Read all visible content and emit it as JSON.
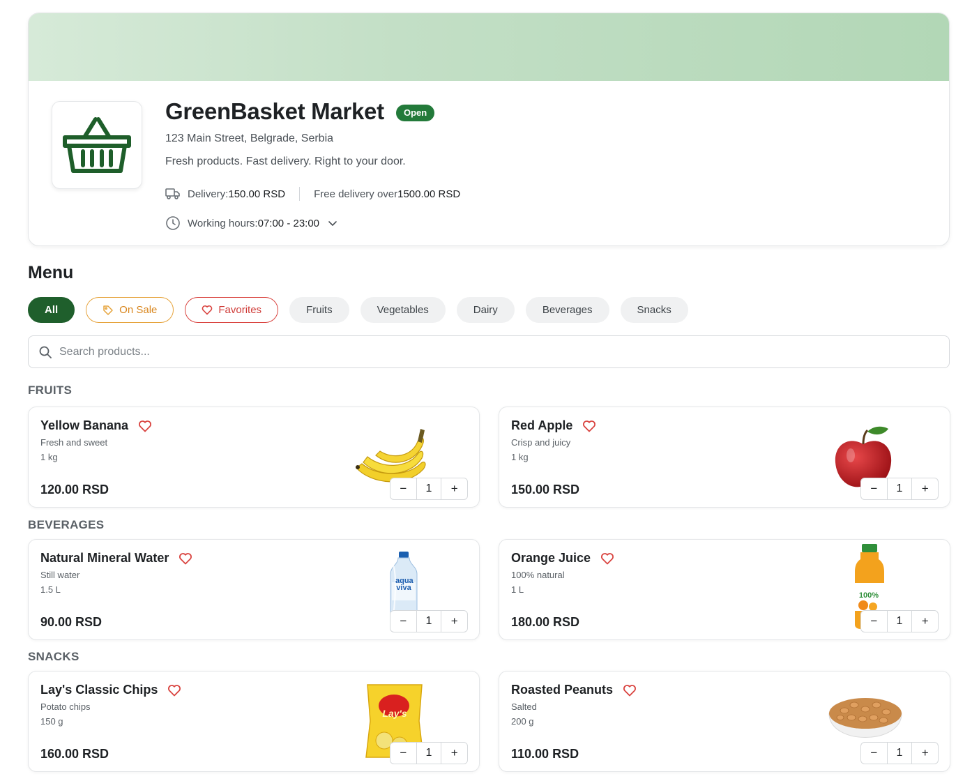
{
  "store": {
    "name": "GreenBasket Market",
    "status": "Open",
    "address": "123 Main Street, Belgrade, Serbia",
    "tagline": "Fresh products. Fast delivery. Right to your door.",
    "delivery_label": "Delivery: ",
    "delivery_value": "150.00 RSD",
    "free_delivery_label": "Free delivery over ",
    "free_delivery_value": "1500.00 RSD",
    "hours_label": "Working hours: ",
    "hours_value": "07:00 - 23:00"
  },
  "menu": {
    "title": "Menu",
    "filters": [
      "All",
      "On Sale",
      "Favorites",
      "Fruits",
      "Vegetables",
      "Dairy",
      "Beverages",
      "Snacks"
    ],
    "active_filter": "All",
    "search_placeholder": "Search products..."
  },
  "sections": [
    {
      "title": "FRUITS",
      "products": [
        {
          "name": "Yellow Banana",
          "description": "Fresh and sweet",
          "quantity": "1 kg",
          "price": "120.00 RSD",
          "count": "1",
          "image": "banana-image"
        },
        {
          "name": "Red Apple",
          "description": "Crisp and juicy",
          "quantity": "1 kg",
          "price": "150.00 RSD",
          "count": "1",
          "image": "apple-image"
        }
      ]
    },
    {
      "title": "BEVERAGES",
      "products": [
        {
          "name": "Natural Mineral Water",
          "description": "Still water",
          "quantity": "1.5 L",
          "price": "90.00 RSD",
          "count": "1",
          "image": "water-bottle-image",
          "image_text": "aqua viva"
        },
        {
          "name": "Orange Juice",
          "description": "100% natural",
          "quantity": "1 L",
          "price": "180.00 RSD",
          "count": "1",
          "image": "juice-bottle-image",
          "image_text": "100%"
        }
      ]
    },
    {
      "title": "SNACKS",
      "products": [
        {
          "name": "Lay's Classic Chips",
          "description": "Potato chips",
          "quantity": "150 g",
          "price": "160.00 RSD",
          "count": "1",
          "image": "chips-bag-image",
          "image_text": "Lay's"
        },
        {
          "name": "Roasted Peanuts",
          "description": "Salted",
          "quantity": "200 g",
          "price": "110.00 RSD",
          "count": "1",
          "image": "peanuts-bowl-image"
        }
      ]
    }
  ],
  "colors": {
    "brand_green": "#1f5f2c",
    "open_badge": "#237a3a",
    "sale_orange": "#e6a33b",
    "favorite_red": "#d9433f"
  },
  "icons": {
    "logo": "basket-icon",
    "delivery": "truck-icon",
    "hours": "clock-icon",
    "hours_toggle": "chevron-down-icon",
    "sale": "tag-icon",
    "favorites": "heart-icon",
    "search": "search-icon",
    "product_favorite": "heart-outline-icon"
  }
}
